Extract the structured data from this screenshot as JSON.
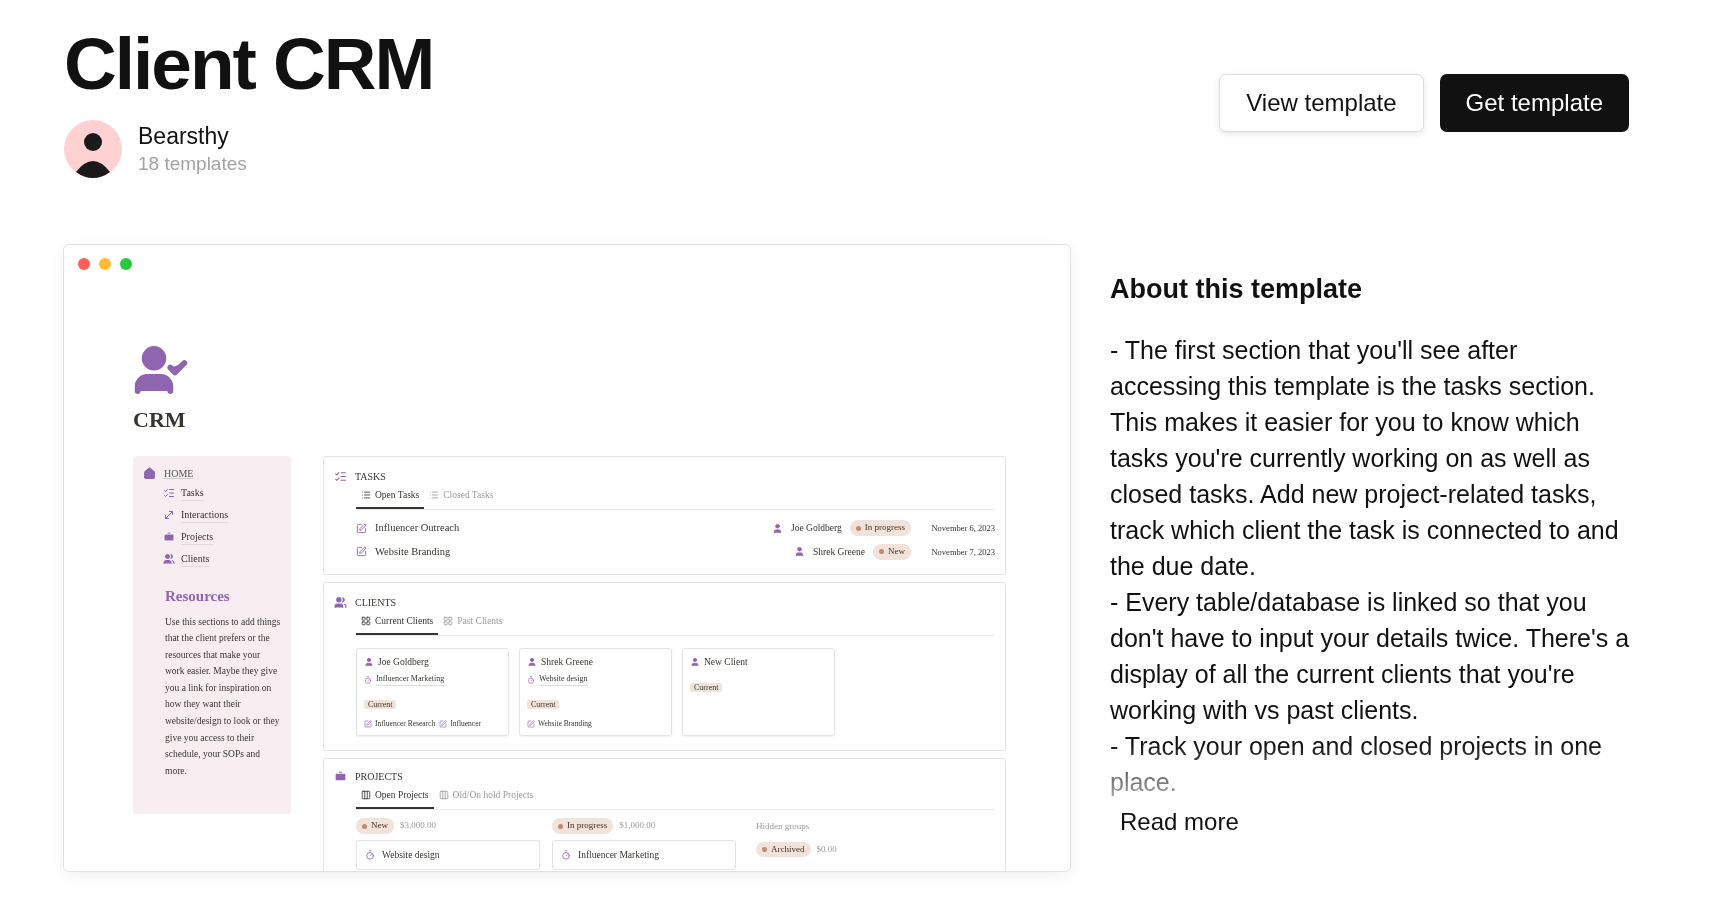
{
  "title": "Client CRM",
  "author": {
    "name": "Bearsthy",
    "templates": "18 templates"
  },
  "buttons": [
    {
      "label": "View template",
      "kind": "secondary"
    },
    {
      "label": "Get template",
      "kind": "primary"
    }
  ],
  "preview": {
    "page_title": "CRM",
    "sidebar": {
      "home": "HOME",
      "items": [
        {
          "label": "Tasks",
          "kind": "tasks"
        },
        {
          "label": "Interactions",
          "kind": "interactions"
        },
        {
          "label": "Projects",
          "kind": "projects"
        },
        {
          "label": "Clients",
          "kind": "clients"
        }
      ],
      "resources_title": "Resources",
      "resources_text": "Use this sections to add things that the client prefers or the resources that make your work easier. Maybe they give you a link for inspiration on how they want their website/design to look or they give you access to their schedule, your SOPs and more."
    },
    "tasks": {
      "heading": "TASKS",
      "tabs": [
        {
          "label": "Open Tasks",
          "selected": true
        },
        {
          "label": "Closed Tasks",
          "selected": false
        }
      ],
      "rows": [
        {
          "title": "Influencer Outreach",
          "person": "Joe Goldberg",
          "status": "In progress",
          "date": "November 6, 2023"
        },
        {
          "title": "Website Branding",
          "person": "Shrek Greene",
          "status": "New",
          "date": "November 7, 2023"
        }
      ]
    },
    "clients": {
      "heading": "CLIENTS",
      "tabs": [
        {
          "label": "Current Clients",
          "selected": true
        },
        {
          "label": "Past Clients",
          "selected": false
        }
      ],
      "cards": [
        {
          "name": "Joe Goldberg",
          "project": "Influencer Marketing",
          "status": "Current",
          "tasks": [
            "Influencer Research",
            "Influencer"
          ]
        },
        {
          "name": "Shrek Greene",
          "project": "Website design",
          "status": "Current",
          "tasks": [
            "Website Branding"
          ]
        },
        {
          "name": "New Client",
          "status": "Current"
        }
      ]
    },
    "projects": {
      "heading": "PROJECTS",
      "tabs": [
        {
          "label": "Open Projects",
          "selected": true
        },
        {
          "label": "Old/On hold Projects",
          "selected": false
        }
      ],
      "groups": [
        {
          "status": "New",
          "amount": "$3,000.00",
          "cards": [
            "Website design"
          ]
        },
        {
          "status": "In progress",
          "amount": "$1,000.00",
          "cards": [
            "Influencer Marketing"
          ]
        }
      ],
      "hidden_label": "Hidden groups",
      "hidden": [
        {
          "status": "Archived",
          "amount": "$0.00"
        }
      ]
    }
  },
  "about": {
    "heading": "About this template",
    "text": "- The first section that you'll see after accessing this template is the tasks section. This makes it easier for you to know which tasks you're currently working on as well as closed tasks. Add new project-related tasks, track which client the task is connected to and the due date.\n- Every table/database is linked so that you don't have to input your details twice. There's a display of all the current clients that you're working with vs past clients.\n- Track your open and closed projects in one place.",
    "read_more": "Read more"
  }
}
